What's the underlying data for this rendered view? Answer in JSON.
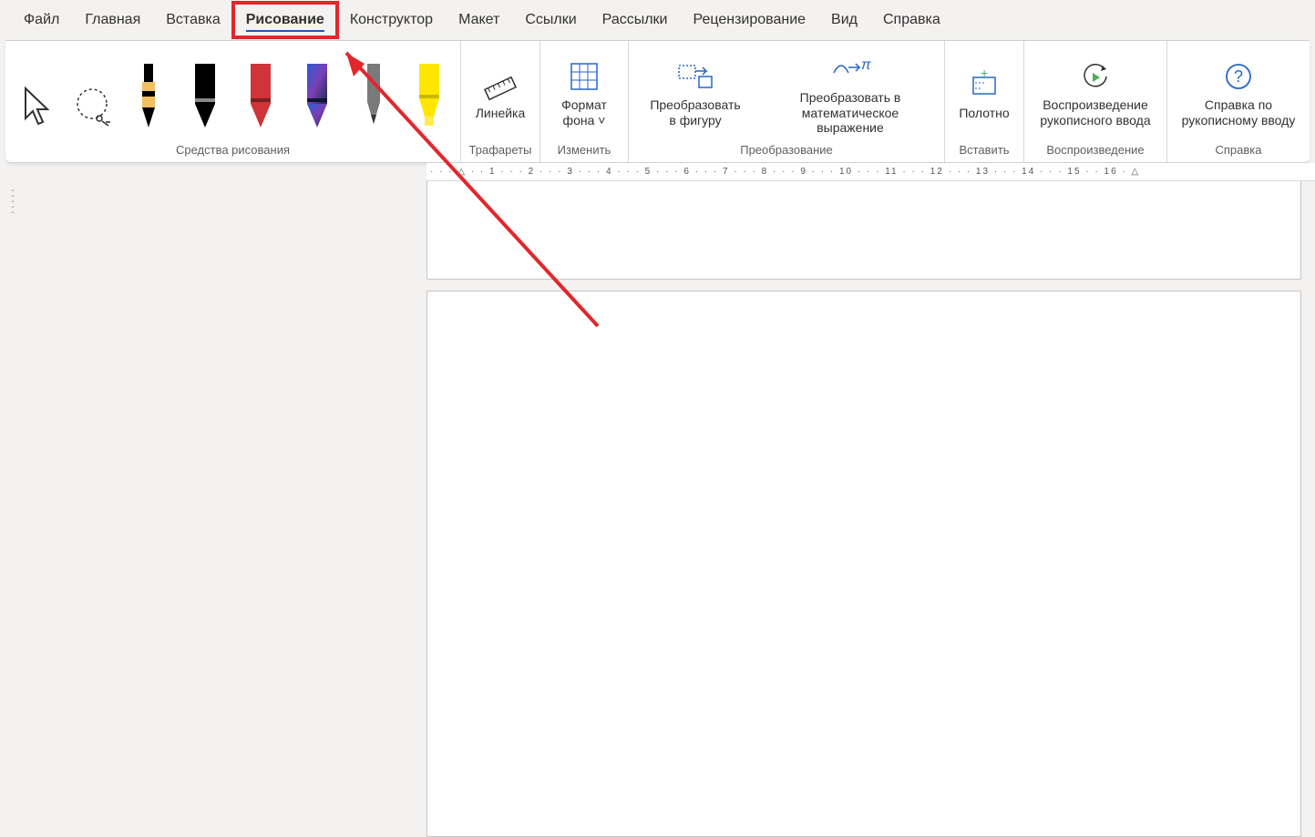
{
  "tabs": {
    "file": "Файл",
    "home": "Главная",
    "insert": "Вставка",
    "draw": "Рисование",
    "design": "Конструктор",
    "layout": "Макет",
    "references": "Ссылки",
    "mailings": "Рассылки",
    "review": "Рецензирование",
    "view": "Вид",
    "help": "Справка"
  },
  "ribbon": {
    "group_tools": "Средства рисования",
    "group_stencils": "Трафареты",
    "group_edit": "Изменить",
    "group_convert": "Преобразование",
    "group_insert": "Вставить",
    "group_replay": "Воспроизведение",
    "group_help": "Справка",
    "ruler": "Линейка",
    "format_bg": "Формат фона",
    "to_shape_l1": "Преобразовать",
    "to_shape_l2": "в фигуру",
    "to_math_l1": "Преобразовать в",
    "to_math_l2": "математическое выражение",
    "canvas": "Полотно",
    "replay_l1": "Воспроизведение",
    "replay_l2": "рукописного ввода",
    "help_l1": "Справка по",
    "help_l2": "рукописному вводу"
  },
  "ruler_text": "· · · △ · · 1 · · · 2 · · · 3 · · · 4 · · · 5 · · · 6 · · · 7 · · · 8 · · · 9 · · · 10 · · · 11 · · · 12 · · · 13 · · · 14 · · · 15 · · 16 · △",
  "pens": [
    {
      "name": "select-tool"
    },
    {
      "name": "lasso-tool"
    },
    {
      "name": "pen-black"
    },
    {
      "name": "pen-black-thick"
    },
    {
      "name": "pen-red"
    },
    {
      "name": "pen-galaxy"
    },
    {
      "name": "pencil-gray"
    },
    {
      "name": "highlighter-yellow"
    }
  ]
}
